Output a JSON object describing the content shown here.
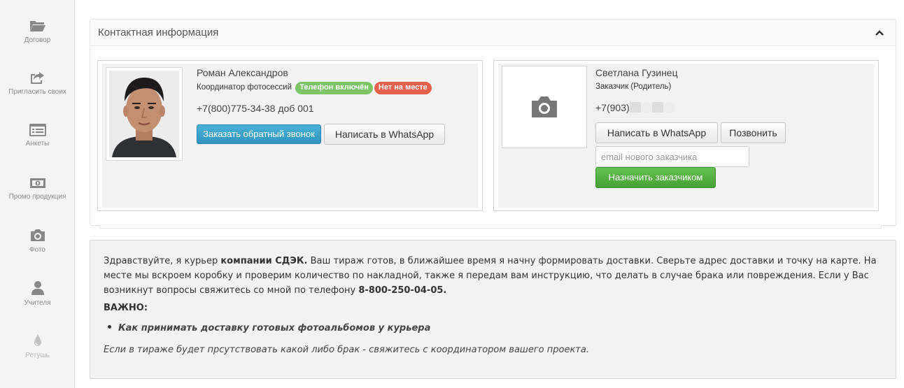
{
  "sidebar": {
    "items": [
      {
        "label": "Договор",
        "icon": "folder-icon"
      },
      {
        "label": "Пригласить своих",
        "icon": "share-icon"
      },
      {
        "label": "Анкеты",
        "icon": "list-icon"
      },
      {
        "label": "Промо продукция",
        "icon": "money-icon"
      },
      {
        "label": "Фото",
        "icon": "camera-icon"
      },
      {
        "label": "Учителя",
        "icon": "user-icon"
      },
      {
        "label": "Ретушь",
        "icon": "drop-icon"
      }
    ]
  },
  "panel": {
    "title": "Контактная информация"
  },
  "coordinator": {
    "name": "Роман Александров",
    "role": "Координатор фотосессий",
    "badge_phone": "Телефон включён",
    "badge_absent": "Нет на месте",
    "phone": "+7(800)775-34-38 доб 001",
    "callback_button": "Заказать обратный звонок",
    "whatsapp_button": "Написать в WhatsApp"
  },
  "customer": {
    "name": "Светлана Гузинец",
    "role": "Заказчик (Родитель)",
    "phone_prefix": "+7(903)",
    "whatsapp_button": "Написать в WhatsApp",
    "call_button": "Позвонить",
    "email_placeholder": "email нового заказчика",
    "assign_button": "Назначить заказчиком"
  },
  "info": {
    "part1": "Здравствуйте, я курьер ",
    "company": "компании СДЭК.",
    "part2": " Ваш тираж готов, в ближайшее время я начну формировать доставки. Сверьте адрес доставки и точку на карте. На месте мы вскроем коробку и проверим количество по накладной, также я передам вам инструкцию, что делать в случае брака или повреждения. Если у Вас возникнут вопросы свяжитесь со мной по телефону ",
    "phone": "8-800-250-04-05.",
    "important": "ВАЖНО:",
    "list_item": "Как принимать доставку готовых фотоальбомов у курьера",
    "note": "Если в тираже будет прсутствовать какой либо брак - свяжитесь с координатором вашего проекта."
  }
}
